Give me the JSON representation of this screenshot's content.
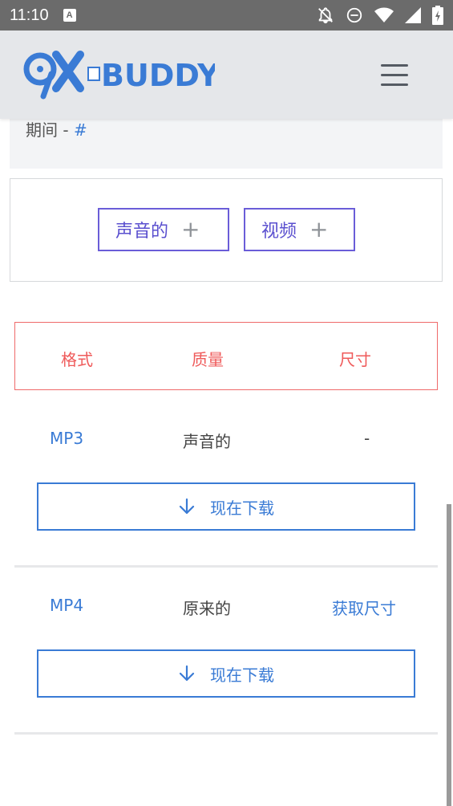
{
  "status_bar": {
    "time": "11:10",
    "notification_badge": "A",
    "icons": [
      "notifications-off-icon",
      "do-not-disturb-icon",
      "wifi-icon",
      "signal-icon",
      "battery-charging-icon"
    ]
  },
  "header": {
    "logo_text": "9XBUDDY",
    "menu_icon": "hamburger-menu-icon"
  },
  "period": {
    "label": "期间 - ",
    "value": "#"
  },
  "type_buttons": [
    {
      "label": "声音的",
      "icon": "plus-icon"
    },
    {
      "label": "视频",
      "icon": "plus-icon"
    }
  ],
  "table": {
    "headers": [
      "格式",
      "质量",
      "尺寸"
    ],
    "rows": [
      {
        "format": "MP3",
        "quality": "声音的",
        "size": "-",
        "download_label": "现在下载"
      },
      {
        "format": "MP4",
        "quality": "原来的",
        "size": "获取尺寸",
        "download_label": "现在下载"
      }
    ]
  },
  "colors": {
    "accent_blue": "#3a7bd5",
    "type_button_purple": "#6a5dd8",
    "header_red": "#ef5a5a",
    "appbar_bg": "#e5e7ea",
    "status_bar_bg": "#6b6b6b"
  }
}
